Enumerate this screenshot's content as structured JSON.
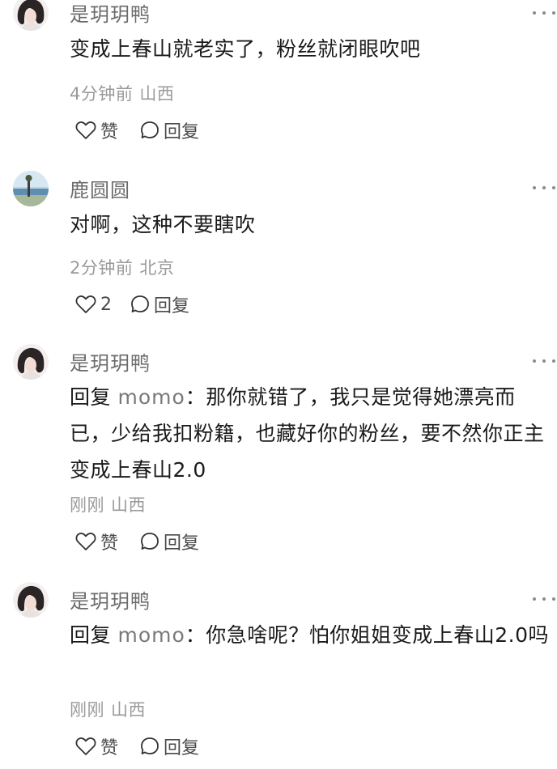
{
  "comments": [
    {
      "username": "是玥玥鸭",
      "reply_prefix": "",
      "reply_target": "",
      "text": "变成上春山就老实了，粉丝就闭眼吹吧",
      "time": "4分钟前",
      "location": "山西",
      "like_label": "赞",
      "reply_label": "回复"
    },
    {
      "username": "鹿圆圆",
      "reply_prefix": "",
      "reply_target": "",
      "text": "对啊，这种不要瞎吹",
      "time": "2分钟前",
      "location": "北京",
      "like_label": "2",
      "reply_label": "回复"
    },
    {
      "username": "是玥玥鸭",
      "reply_prefix": "回复",
      "reply_target": "momo",
      "text": "：那你就错了，我只是觉得她漂亮而已，少给我扣粉籍，也藏好你的粉丝，要不然你正主变成上春山2.0",
      "time": "刚刚",
      "location": "山西",
      "like_label": "赞",
      "reply_label": "回复"
    },
    {
      "username": "是玥玥鸭",
      "reply_prefix": "回复",
      "reply_target": "momo",
      "text": "：你急啥呢？怕你姐姐变成上春山2.0吗",
      "time": "刚刚",
      "location": "山西",
      "like_label": "赞",
      "reply_label": "回复"
    }
  ],
  "icons": {
    "like": "heart-outline",
    "reply": "speech-bubble-outline",
    "more": "three-dots"
  },
  "colors": {
    "username": "#6b6b6b",
    "meta": "#9a9a9a",
    "body_text": "#1a1a1a",
    "icon_stroke": "#333333"
  }
}
